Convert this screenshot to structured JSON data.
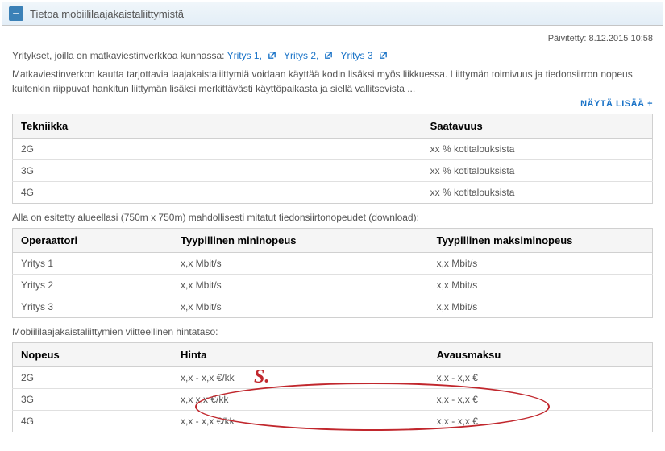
{
  "header": {
    "title": "Tietoa mobiililaajakaistaliittymistä",
    "collapse_label": "−"
  },
  "updated": {
    "label": "Päivitetty:",
    "value": "8.12.2015 10:58"
  },
  "companies_line": {
    "prefix": "Yritykset, joilla on matkaviestinverkkoa kunnassa:"
  },
  "companies": [
    {
      "label": "Yritys 1,"
    },
    {
      "label": "Yritys 2,"
    },
    {
      "label": "Yritys 3"
    }
  ],
  "description": "Matkaviestinverkon kautta tarjottavia laajakaistaliittymiä voidaan käyttää kodin lisäksi myös liikkuessa. Liittymän toimivuus ja tiedonsiirron nopeus kuitenkin riippuvat hankitun liittymän lisäksi merkittävästi käyttöpaikasta ja siellä vallitsevista ...",
  "show_more_label": "NÄYTÄ LISÄÄ +",
  "table_avail": {
    "cols": [
      "Tekniikka",
      "Saatavuus"
    ],
    "rows": [
      {
        "tech": "2G",
        "avail": "xx % kotitalouksista"
      },
      {
        "tech": "3G",
        "avail": "xx % kotitalouksista"
      },
      {
        "tech": "4G",
        "avail": "xx % kotitalouksista"
      }
    ]
  },
  "speeds_caption": "Alla on esitetty alueellasi (750m x 750m) mahdollisesti mitatut tiedonsiirtonopeudet (download):",
  "table_speeds": {
    "cols": [
      "Operaattori",
      "Tyypillinen mininopeus",
      "Tyypillinen maksiminopeus"
    ],
    "rows": [
      {
        "op": "Yritys 1",
        "min": "x,x Mbit/s",
        "max": "x,x Mbit/s"
      },
      {
        "op": "Yritys 2",
        "min": "x,x Mbit/s",
        "max": "x,x Mbit/s"
      },
      {
        "op": "Yritys 3",
        "min": "x,x Mbit/s",
        "max": "x,x Mbit/s"
      }
    ]
  },
  "price_caption": "Mobiililaajakaistaliittymien viitteellinen hintataso:",
  "table_price": {
    "cols": [
      "Nopeus",
      "Hinta",
      "Avausmaksu"
    ],
    "rows": [
      {
        "speed": "2G",
        "price": "x,x - x,x  €/kk",
        "open": "x,x - x,x   €"
      },
      {
        "speed": "3G",
        "price": "x,x  x,x  €/kk",
        "open": "x,x - x,x  €"
      },
      {
        "speed": "4G",
        "price": "x,x - x,x  €/kk",
        "open": "x,x - x,x  €"
      }
    ]
  },
  "annotation_label": "S."
}
